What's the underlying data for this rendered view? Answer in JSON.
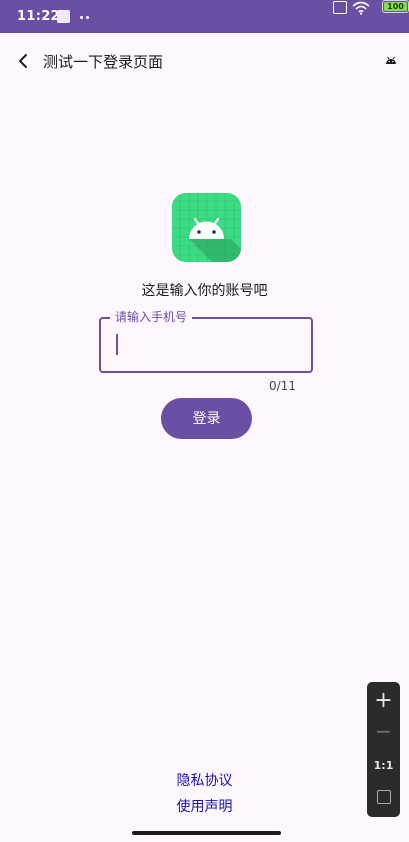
{
  "status_bar": {
    "time": "11:22",
    "battery": "100",
    "icons": [
      "app-notification-icon",
      "sim-off-icon",
      "wifi-icon",
      "battery-icon"
    ]
  },
  "toolbar": {
    "title": "测试一下登录页面",
    "back_icon": "chevron-left-icon",
    "right_icon": "android-icon"
  },
  "main": {
    "app_icon": "android-app-icon",
    "prompt": "这是输入你的账号吧",
    "phone_field": {
      "label": "请输入手机号",
      "value": "",
      "counter": "0/11"
    },
    "login_label": "登录"
  },
  "footer": {
    "privacy_label": "隐私协议",
    "terms_label": "使用声明"
  },
  "zoom_controls": {
    "reset_label": "1:1"
  },
  "colors": {
    "primary": "#6a4fa5",
    "background": "#fff7fe",
    "link": "#1a0fb5",
    "android_green": "#3ddc84"
  }
}
